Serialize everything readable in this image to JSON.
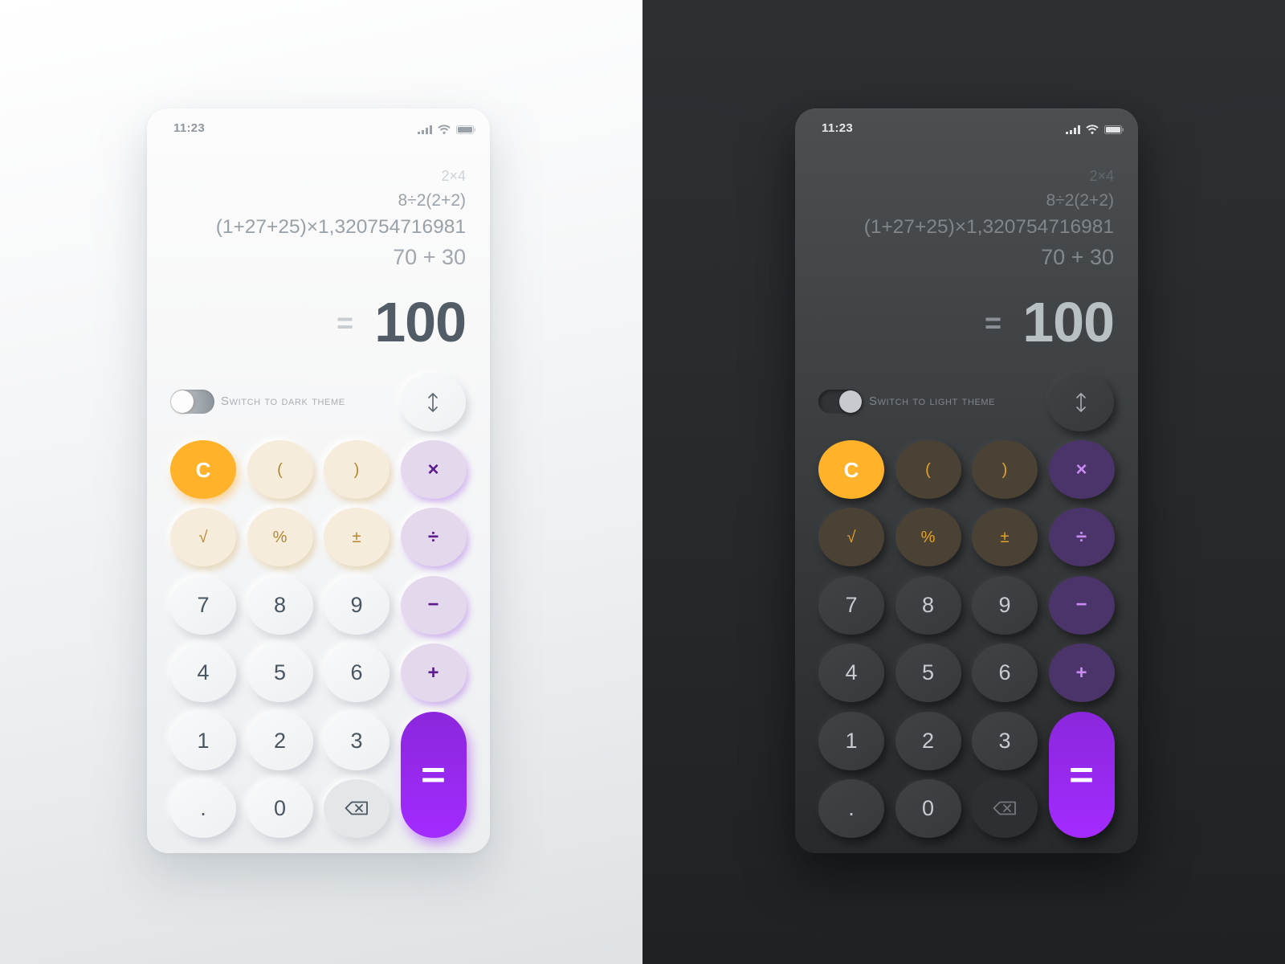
{
  "themes": [
    {
      "id": "light",
      "status": {
        "time": "11:23"
      },
      "history": [
        "2×4",
        "8÷2(2+2)",
        "(1+27+25)×1,320754716981",
        "70 + 30"
      ],
      "result": {
        "equals": "=",
        "value": "100"
      },
      "theme_toggle": {
        "label": "Switch to dark theme",
        "on": false
      },
      "colors": {
        "background": "#eceef0",
        "number_key": "#f3f4f5",
        "function_key": "#f5ecdc",
        "operator_key": "#e3d8ec",
        "text": "#4a5562"
      }
    },
    {
      "id": "dark",
      "status": {
        "time": "11:23"
      },
      "history": [
        "2×4",
        "8÷2(2+2)",
        "(1+27+25)×1,320754716981",
        "70 + 30"
      ],
      "result": {
        "equals": "=",
        "value": "100"
      },
      "theme_toggle": {
        "label": "Switch to light theme",
        "on": true
      },
      "colors": {
        "background": "#26292b",
        "number_key": "#3b3d40",
        "function_key": "#4a4235",
        "operator_key": "#4b3469",
        "text": "#c8ccd0"
      }
    }
  ],
  "icons": {
    "status": [
      "signal-icon",
      "wifi-icon",
      "battery-icon"
    ],
    "swap": "swap-vertical-icon",
    "backspace": "backspace-icon"
  },
  "keypad": {
    "keys": [
      "C",
      "(",
      ")",
      "×",
      "√",
      "%",
      "±",
      "÷",
      "7",
      "8",
      "9",
      "−",
      "4",
      "5",
      "6",
      "+",
      "1",
      "2",
      "3",
      "=",
      ".",
      "0",
      "⌫"
    ]
  },
  "accent_colors": {
    "clear": "#ffb22a",
    "equals": "#9b2bf5"
  }
}
